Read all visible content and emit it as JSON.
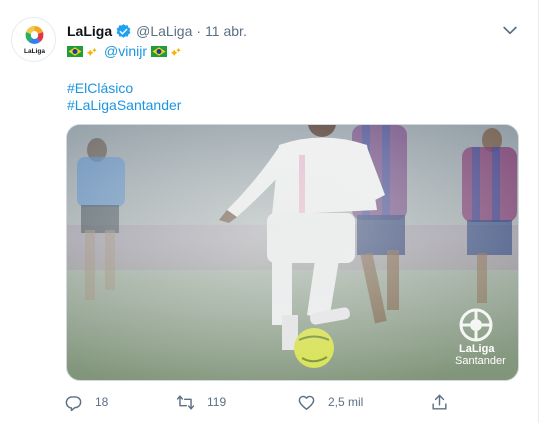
{
  "tweet": {
    "author_name": "LaLiga",
    "author_handle": "@LaLiga",
    "separator": "·",
    "date": "11 abr.",
    "mention": "@vinijr",
    "hashtags": [
      "#ElClásico",
      "#LaLigaSantander"
    ],
    "avatar_text": "LaLiga"
  },
  "media": {
    "watermark_line1": "LaLiga",
    "watermark_line2": "Santander"
  },
  "actions": {
    "reply_count": "18",
    "retweet_count": "119",
    "like_count": "2,5 mil"
  },
  "colors": {
    "link": "#1b95e0",
    "muted": "#5b7083",
    "verified": "#1da1f2"
  },
  "icons": {
    "reply": "reply-icon",
    "retweet": "retweet-icon",
    "like": "heart-icon",
    "share": "share-icon",
    "more": "more-icon",
    "verified": "verified-badge-icon",
    "flag": "brazil-flag-icon",
    "sparkle": "sparkles-icon"
  }
}
